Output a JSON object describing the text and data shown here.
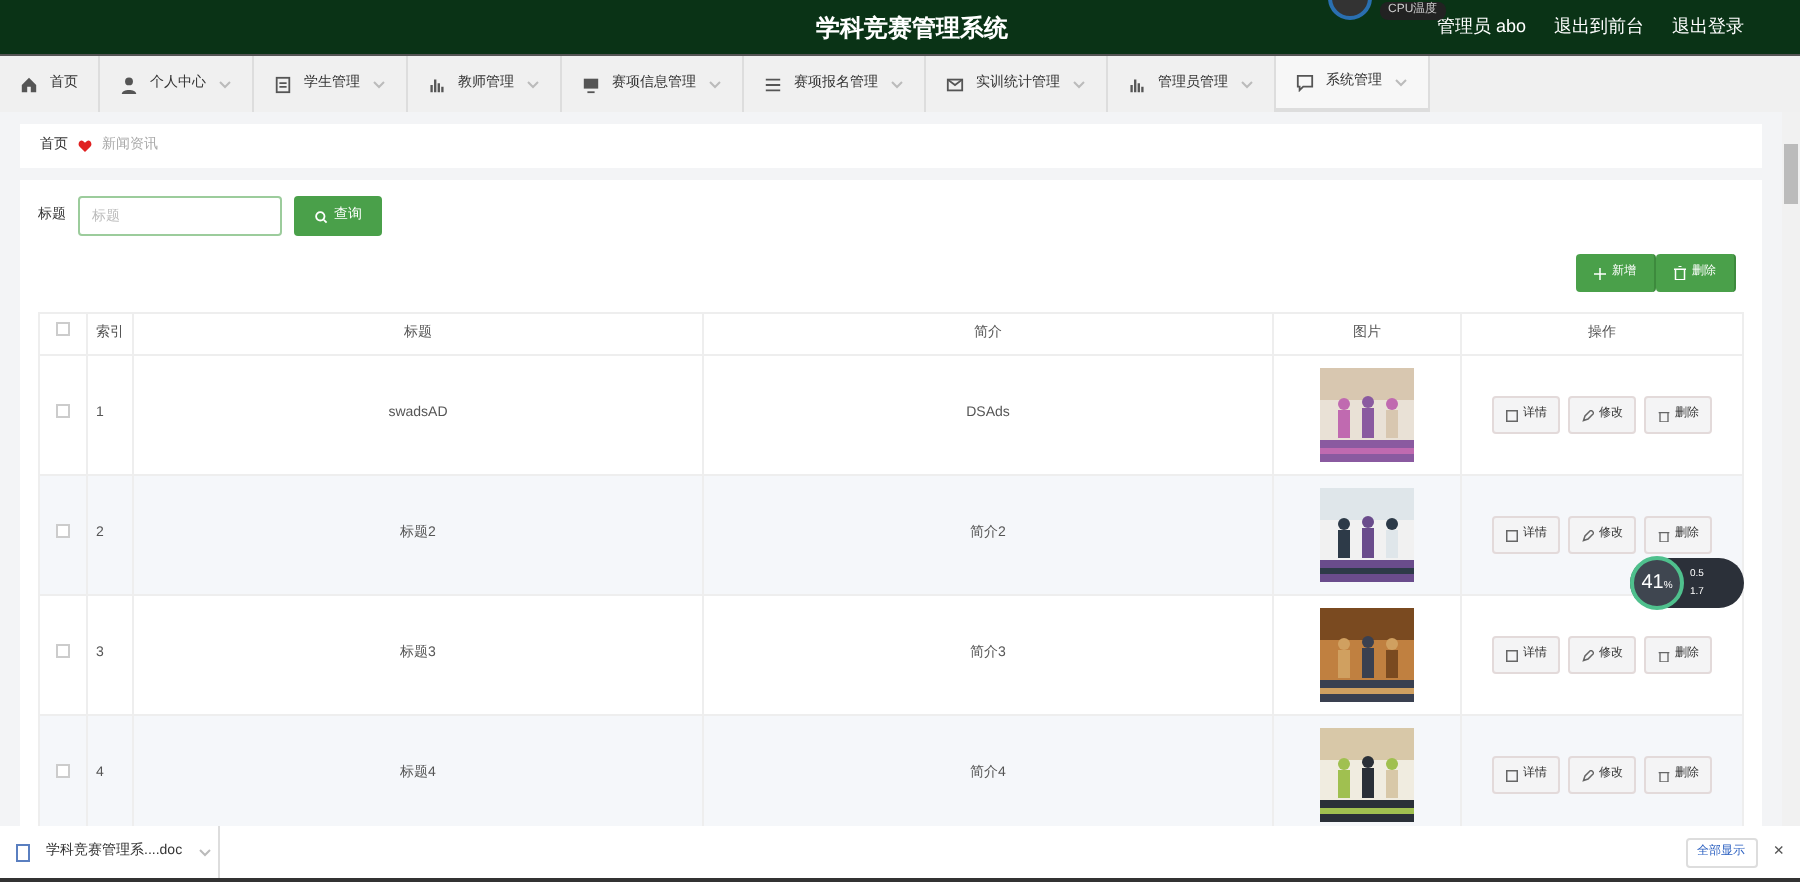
{
  "header": {
    "title": "学科竞赛管理系统",
    "user": "管理员 abo",
    "links": [
      "退出到前台",
      "退出登录"
    ],
    "cpu_widget": "CPU温度"
  },
  "nav": [
    {
      "label": "首页",
      "selected": false,
      "dropdown": false
    },
    {
      "label": "个人中心",
      "selected": false,
      "dropdown": true
    },
    {
      "label": "学生管理",
      "selected": false,
      "dropdown": true
    },
    {
      "label": "教师管理",
      "selected": false,
      "dropdown": true
    },
    {
      "label": "赛项信息管理",
      "selected": false,
      "dropdown": true
    },
    {
      "label": "赛项报名管理",
      "selected": false,
      "dropdown": true
    },
    {
      "label": "实训统计管理",
      "selected": false,
      "dropdown": true
    },
    {
      "label": "管理员管理",
      "selected": false,
      "dropdown": true
    },
    {
      "label": "系统管理",
      "selected": true,
      "dropdown": true
    }
  ],
  "breadcrumb": [
    "首页",
    "新闻资讯"
  ],
  "search": {
    "label": "标题",
    "placeholder": "标题",
    "button": "查询"
  },
  "actions": [
    "新增",
    "删除"
  ],
  "table": {
    "all_checked": false,
    "columns": [
      "索引",
      "标题",
      "简介",
      "图片",
      "操作"
    ],
    "rows": [
      {
        "checked": false,
        "index": "1",
        "title": "swadsAD",
        "intro": "DSAds",
        "image": {
          "kind": "picture"
        },
        "buttons": [
          "详情",
          "修改",
          "删除"
        ]
      },
      {
        "checked": false,
        "index": "2",
        "title": "标题2",
        "intro": "简介2",
        "image": {
          "kind": "picture"
        },
        "buttons": [
          "详情",
          "修改",
          "删除"
        ]
      },
      {
        "checked": false,
        "index": "3",
        "title": "标题3",
        "intro": "简介3",
        "image": {
          "kind": "picture"
        },
        "buttons": [
          "详情",
          "修改",
          "删除"
        ]
      },
      {
        "checked": false,
        "index": "4",
        "title": "标题4",
        "intro": "简介4",
        "image": {
          "kind": "picture"
        },
        "buttons": [
          "详情",
          "修改",
          "删除"
        ]
      }
    ]
  },
  "speed_widget": {
    "percent": "41",
    "unit": "%",
    "up": "0.5",
    "down": "1.7"
  },
  "download_bar": {
    "file": "学科竞赛管理系....doc",
    "button": "全部显示",
    "close": "×"
  }
}
